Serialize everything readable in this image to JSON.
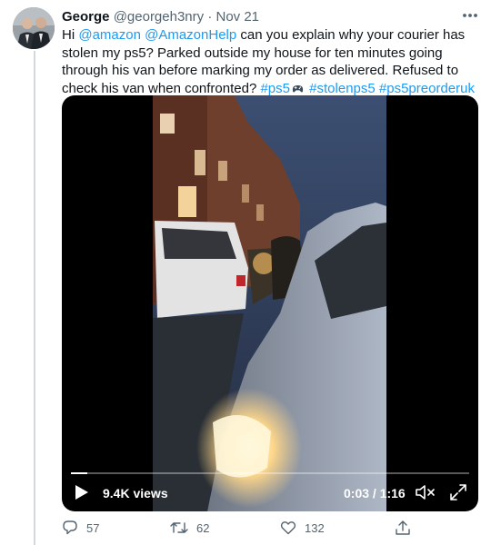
{
  "tweet": {
    "author_name": "George",
    "author_handle": "@georgeh3nry",
    "separator": "·",
    "date": "Nov 21",
    "text_parts": {
      "t1": "Hi ",
      "m1": "@amazon",
      "t2": " ",
      "m2": "@AmazonHelp",
      "t3": " can you explain why your courier has stolen my ps5? Parked outside my house for ten minutes going through his van before marking my order as delivered. Refused to check his van when confronted? ",
      "h1": "#ps5",
      "h2": "#stolenps5",
      "t4": " ",
      "h3": "#ps5preorderuk"
    }
  },
  "video": {
    "views": "9.4K views",
    "time": "0:03 / 1:16",
    "progress": 0.04
  },
  "actions": {
    "replies": "57",
    "retweets": "62",
    "likes": "132"
  },
  "colors": {
    "link": "#1d9bf0",
    "muted": "#536471",
    "text": "#0f1419"
  }
}
